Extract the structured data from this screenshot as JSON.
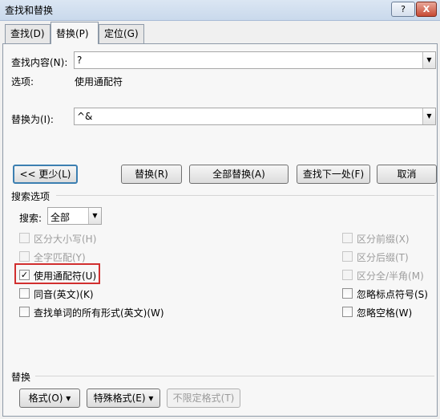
{
  "window": {
    "title": "查找和替换",
    "help_label": "?",
    "close_label": "X"
  },
  "tabs": [
    {
      "label": "查找(D)",
      "active": false
    },
    {
      "label": "替换(P)",
      "active": true
    },
    {
      "label": "定位(G)",
      "active": false
    }
  ],
  "find": {
    "label": "查找内容(N):",
    "value": "?",
    "options_label": "选项:",
    "options_value": "使用通配符"
  },
  "replace": {
    "label": "替换为(I):",
    "value": "^&"
  },
  "buttons": {
    "less": "<< 更少(L)",
    "replace": "替换(R)",
    "replace_all": "全部替换(A)",
    "find_next": "查找下一处(F)",
    "cancel": "取消"
  },
  "search_options": {
    "title": "搜索选项",
    "search_label": "搜索:",
    "search_value": "全部"
  },
  "options_left": [
    {
      "label": "区分大小写(H)",
      "checked": false,
      "enabled": false
    },
    {
      "label": "全字匹配(Y)",
      "checked": false,
      "enabled": false
    },
    {
      "label": "使用通配符(U)",
      "checked": true,
      "enabled": true
    },
    {
      "label": "同音(英文)(K)",
      "checked": false,
      "enabled": true
    },
    {
      "label": "查找单词的所有形式(英文)(W)",
      "checked": false,
      "enabled": true
    }
  ],
  "options_right": [
    {
      "label": "区分前缀(X)",
      "checked": false,
      "enabled": false
    },
    {
      "label": "区分后缀(T)",
      "checked": false,
      "enabled": false
    },
    {
      "label": "区分全/半角(M)",
      "checked": false,
      "enabled": false
    },
    {
      "label": "忽略标点符号(S)",
      "checked": false,
      "enabled": true
    },
    {
      "label": "忽略空格(W)",
      "checked": false,
      "enabled": true
    }
  ],
  "replace_section": {
    "title": "替换",
    "format_label": "格式(O) ▾",
    "special_label": "特殊格式(E) ▾",
    "no_format_label": "不限定格式(T)"
  },
  "icons": {
    "dropdown": "chevron-down-icon",
    "check": "check-icon"
  }
}
